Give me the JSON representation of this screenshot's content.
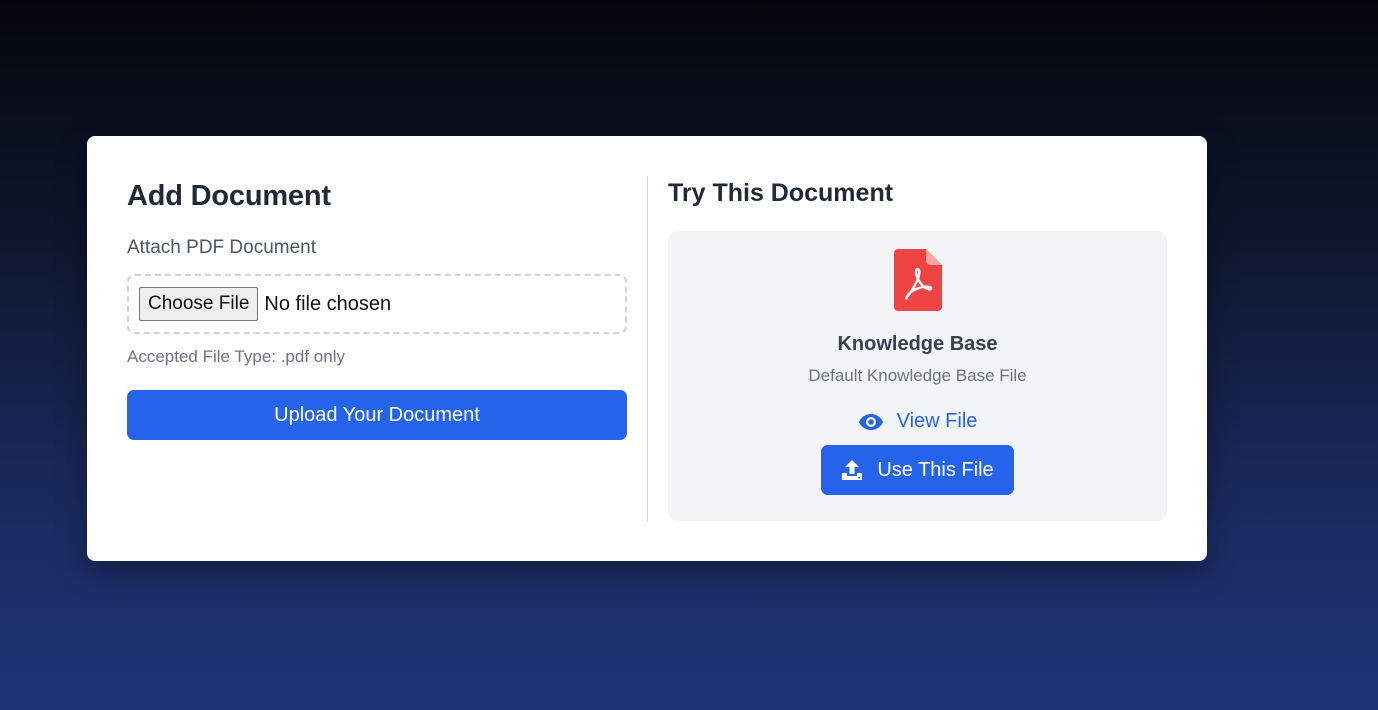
{
  "add_document": {
    "title": "Add Document",
    "attach_label": "Attach PDF Document",
    "choose_file_label": "Choose File",
    "no_file_text": "No file chosen",
    "accepted_hint": "Accepted File Type: .pdf only",
    "upload_button": "Upload Your Document"
  },
  "try_document": {
    "title": "Try This Document",
    "file": {
      "icon": "pdf-file-icon",
      "name": "Knowledge Base",
      "description": "Default Knowledge Base File"
    },
    "view_link": "View File",
    "use_button": "Use This File"
  },
  "colors": {
    "accent": "#2563eb",
    "pdf_icon": "#ef4444",
    "panel_bg": "#f3f4f6"
  }
}
